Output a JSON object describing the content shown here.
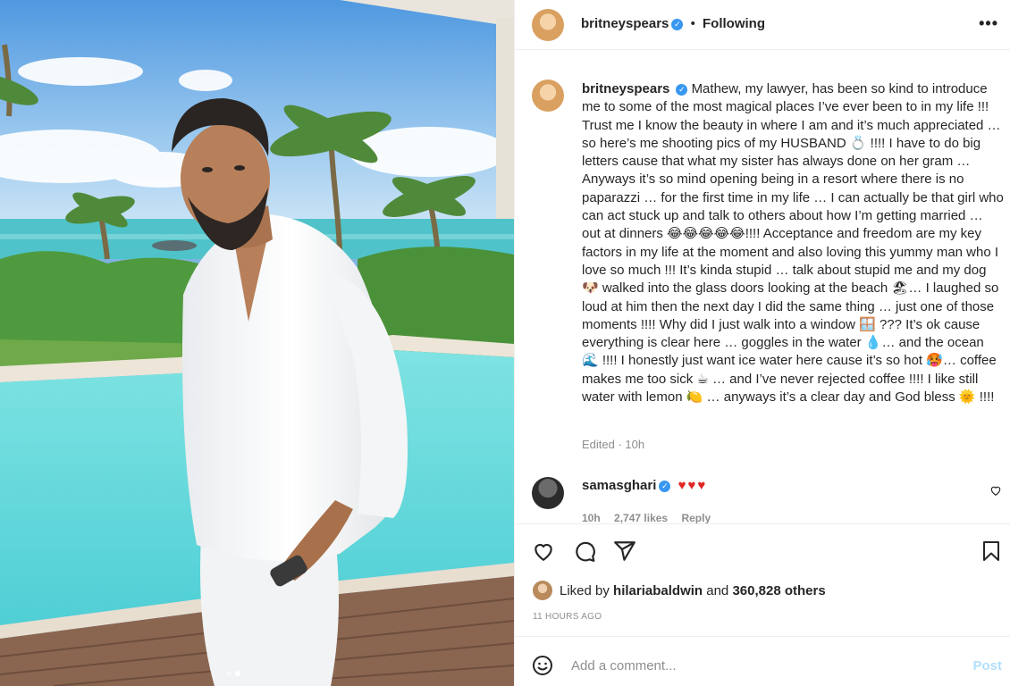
{
  "post": {
    "username": "britneyspears",
    "verified_mark": "✓",
    "separator": "•",
    "follow_status": "Following",
    "more_icon": "•••",
    "photo_indicator": {
      "count": 2,
      "active": 2
    }
  },
  "caption": {
    "username": "britneyspears",
    "text": "Mathew, my lawyer, has been so kind to introduce me to some of the most magical places I’ve ever been to in my life !!! Trust me I know the beauty in where I am and it’s much appreciated … so here’s me shooting pics of my HUSBAND 💍 !!!! I have to do big letters cause that what my sister has always done on her gram … Anyways it’s so mind opening being in a resort where there is no paparazzi … for the first time in my life … I can actually be that girl who can act stuck up and talk to others about how I’m getting married … out at dinners 😂😂😂😂😂!!!! Acceptance and freedom are my key factors in my life at the moment and also loving this yummy man who I love so much !!! It’s kinda stupid … talk about stupid me and my dog 🐶 walked into the glass doors looking at the beach 🏖… I laughed so loud at him then the next day I did the same thing … just one of those moments !!!! Why did I just walk into a window 🪟 ??? It’s ok cause everything is clear here … goggles in the water 💧… and the ocean 🌊 !!!! I honestly just want ice water here cause it’s so hot 🥵… coffee makes me too sick ☕ … and I’ve never rejected coffee !!!! I like still water with lemon 🍋 … anyways it’s a clear day and God bless 🌞 !!!!",
    "edited": "Edited · 10h"
  },
  "reply": {
    "username": "samasghari",
    "text": "♥♥♥",
    "time": "10h",
    "likes": "2,747 likes",
    "reply_label": "Reply"
  },
  "likes": {
    "prefix": "Liked by",
    "user": "hilariabaldwin",
    "middle": "and",
    "count": "360,828 others"
  },
  "timeago": "11 HOURS AGO",
  "comment_box": {
    "placeholder": "Add a comment...",
    "post_label": "Post"
  },
  "icons": [
    "heart-icon",
    "comment-icon",
    "share-icon",
    "bookmark-icon",
    "emoji-icon",
    "verified-icon"
  ],
  "colors": {
    "accent": "#3897f0",
    "post_disabled": "#b2dffc",
    "heart": "#e02424",
    "muted": "#8e8e8e"
  }
}
